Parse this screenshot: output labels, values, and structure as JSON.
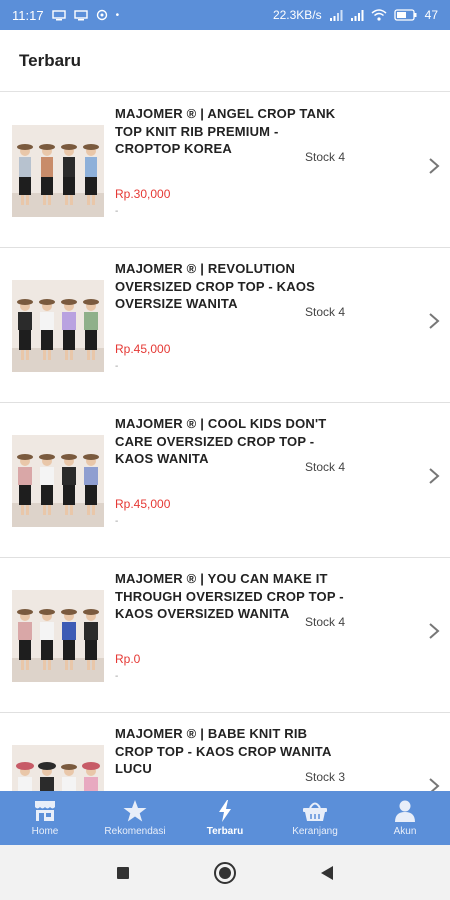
{
  "status_bar": {
    "time": "11:17",
    "network_speed": "22.3KB/s",
    "battery": "47"
  },
  "header": {
    "title": "Terbaru"
  },
  "products": [
    {
      "name": "MAJOMER ® | ANGEL CROP TANK TOP KNIT RIB PREMIUM - CROPTOP KOREA",
      "stock": "Stock 4",
      "price": "Rp.30,000",
      "sub": "-"
    },
    {
      "name": "MAJOMER ® | REVOLUTION OVERSIZED CROP TOP - KAOS OVERSIZE WANITA",
      "stock": "Stock 4",
      "price": "Rp.45,000",
      "sub": "-"
    },
    {
      "name": "MAJOMER ® | COOL KIDS DON'T CARE OVERSIZED CROP TOP - KAOS WANITA",
      "stock": "Stock 4",
      "price": "Rp.45,000",
      "sub": "-"
    },
    {
      "name": "MAJOMER ® | YOU CAN MAKE IT THROUGH OVERSIZED CROP TOP - KAOS OVERSIZED WANITA",
      "stock": "Stock 4",
      "price": "Rp.0",
      "sub": "-"
    },
    {
      "name": "MAJOMER ® | BABE KNIT RIB CROP TOP - KAOS CROP WANITA LUCU",
      "stock": "Stock 3",
      "price": "",
      "sub": ""
    }
  ],
  "bottom_nav": [
    {
      "label": "Home",
      "icon": "store-icon"
    },
    {
      "label": "Rekomendasi",
      "icon": "star-icon"
    },
    {
      "label": "Terbaru",
      "icon": "lightning-icon",
      "active": true
    },
    {
      "label": "Keranjang",
      "icon": "basket-icon"
    },
    {
      "label": "Akun",
      "icon": "user-icon"
    }
  ],
  "colors": {
    "primary": "#5b8fd9",
    "price": "#e53935"
  }
}
